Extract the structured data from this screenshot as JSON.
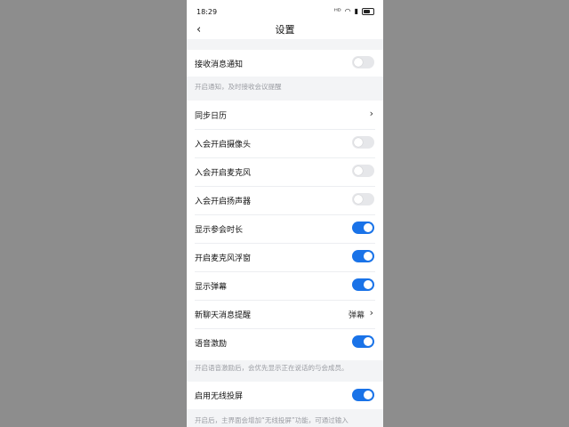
{
  "status_bar": {
    "time": "18:29",
    "battery": "85"
  },
  "header": {
    "title": "设置",
    "back_glyph": "‹"
  },
  "settings": {
    "receive_notifications": {
      "label": "接收消息通知",
      "enabled": false
    },
    "receive_notifications_hint": "开启通知，及时接收会议提醒",
    "sync_calendar": {
      "label": "同步日历"
    },
    "camera_on_join": {
      "label": "入会开启摄像头",
      "enabled": false
    },
    "mic_on_join": {
      "label": "入会开启麦克风",
      "enabled": false
    },
    "speaker_on_join": {
      "label": "入会开启扬声器",
      "enabled": false
    },
    "show_duration": {
      "label": "显示参会时长",
      "enabled": true
    },
    "mic_float_window": {
      "label": "开启麦克风浮窗",
      "enabled": true
    },
    "show_danmaku": {
      "label": "显示弹幕",
      "enabled": true
    },
    "new_chat_alert": {
      "label": "新聊天消息提醒",
      "value": "弹幕"
    },
    "voice_incentive": {
      "label": "语音激励",
      "enabled": true
    },
    "voice_incentive_hint": "开启语音激励后，会优先显示正在说话的与会成员。",
    "wireless_projection": {
      "label": "启用无线投屏",
      "enabled": true
    },
    "wireless_projection_hint": "开启后，主界面会增加“无线投屏”功能，可通过输入"
  },
  "colors": {
    "toggle_on": "#1a73e8",
    "toggle_off": "#e6e7ea"
  }
}
